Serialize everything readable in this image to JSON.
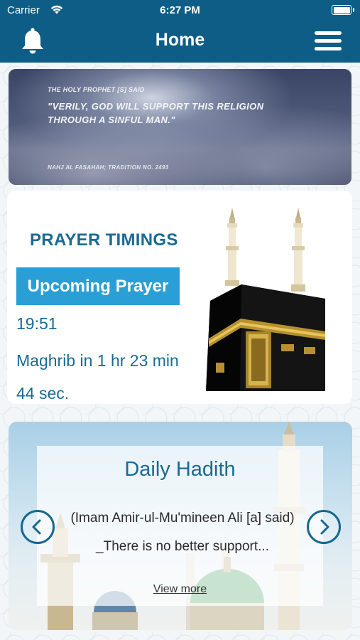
{
  "status_bar": {
    "carrier": "Carrier",
    "time": "6:27 PM",
    "wifi_icon": "wifi-icon",
    "battery_icon": "battery-icon"
  },
  "nav": {
    "title": "Home",
    "left_icon": "bell-icon",
    "right_icon": "hamburger-menu-icon"
  },
  "quote_banner": {
    "source_top": "THE HOLY PROPHET [S] SAID",
    "quote": "\"VERILY, GOD WILL SUPPORT THIS RELIGION THROUGH A SINFUL MAN.\"",
    "reference": "NAHJ AL FASAHAH; TRADITION NO. 2493"
  },
  "prayer": {
    "title": "PRAYER TIMINGS",
    "button_label": "Upcoming Prayer",
    "time": "19:51",
    "remaining": "Maghrib in 1 hr 23 min 44 sec.",
    "image_icon": "kaaba-image"
  },
  "hadith": {
    "title": "Daily Hadith",
    "text": "(Imam Amir-ul-Mu'mineen Ali [a] said) _There is no better support...",
    "view_more": "View more",
    "prev_icon": "chevron-left-icon",
    "next_icon": "chevron-right-icon"
  },
  "colors": {
    "nav_bg": "#0d5d86",
    "accent": "#2a9fd6",
    "text_primary": "#1a6a94"
  }
}
